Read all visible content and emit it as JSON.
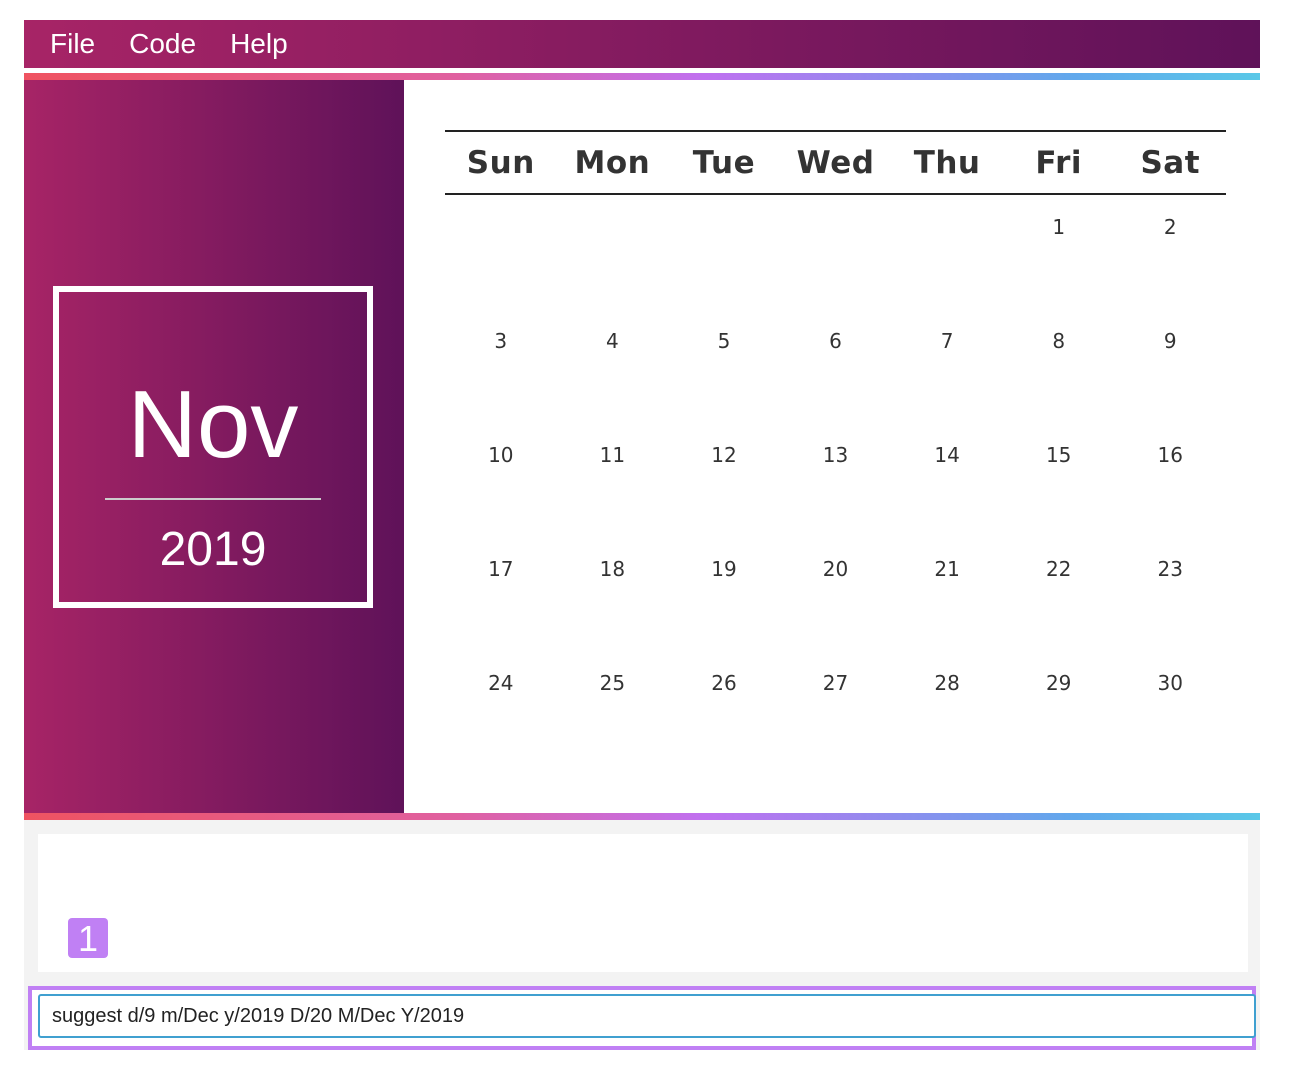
{
  "menu": [
    "File",
    "Code",
    "Help"
  ],
  "month_card": {
    "month": "Nov",
    "year": "2019"
  },
  "calendar": {
    "weekdays": [
      "Sun",
      "Mon",
      "Tue",
      "Wed",
      "Thu",
      "Fri",
      "Sat"
    ],
    "weeks": [
      [
        "",
        "",
        "",
        "",
        "",
        "1",
        "2"
      ],
      [
        "3",
        "4",
        "5",
        "6",
        "7",
        "8",
        "9"
      ],
      [
        "10",
        "11",
        "12",
        "13",
        "14",
        "15",
        "16"
      ],
      [
        "17",
        "18",
        "19",
        "20",
        "21",
        "22",
        "23"
      ],
      [
        "24",
        "25",
        "26",
        "27",
        "28",
        "29",
        "30"
      ]
    ]
  },
  "result_badge": "1",
  "command": {
    "value": "suggest d/9 m/Dec y/2019 D/20 M/Dec Y/2019"
  },
  "colors": {
    "gradient_start": "#a72466",
    "gradient_end": "#5f1259",
    "badge": "#c080f4",
    "input_border": "#40a0d0"
  }
}
